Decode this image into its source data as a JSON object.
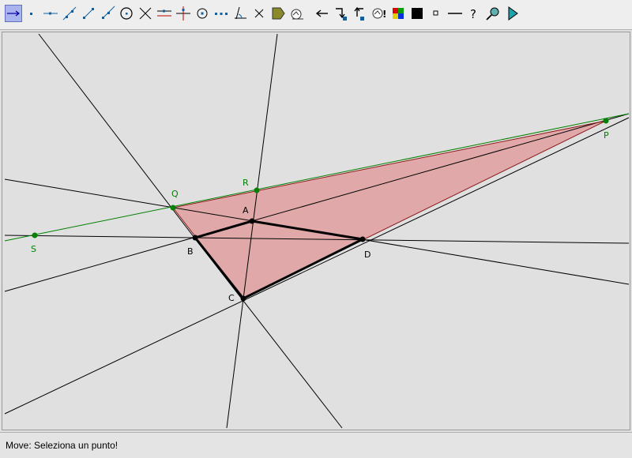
{
  "toolbar": {
    "tools": [
      {
        "name": "move-tool-icon",
        "active": true
      },
      {
        "name": "point-tool-icon"
      },
      {
        "name": "point-on-line-tool-icon"
      },
      {
        "name": "line-tool-icon"
      },
      {
        "name": "segment-tool-icon"
      },
      {
        "name": "ray-tool-icon"
      },
      {
        "name": "circle-tool-icon"
      },
      {
        "name": "intersection-tool-icon"
      },
      {
        "name": "parallel-tool-icon"
      },
      {
        "name": "perpendicular-tool-icon"
      },
      {
        "name": "center-tool-icon"
      },
      {
        "name": "midpoint-tool-icon"
      },
      {
        "name": "angle-tool-icon"
      },
      {
        "name": "delete-tool-icon"
      },
      {
        "name": "polygon-tool-icon"
      },
      {
        "name": "locus-tool-icon"
      },
      {
        "name": "undo-tool-icon"
      },
      {
        "name": "redo-tool-icon"
      },
      {
        "name": "back-tool-icon"
      },
      {
        "name": "animation-tool-icon"
      },
      {
        "name": "color-tool-icon"
      },
      {
        "name": "fill-tool-icon"
      },
      {
        "name": "point-size-tool-icon"
      },
      {
        "name": "line-style-tool-icon"
      },
      {
        "name": "help-tool-icon"
      },
      {
        "name": "zoom-tool-icon"
      },
      {
        "name": "run-tool-icon"
      }
    ]
  },
  "colors": {
    "construction_line": "#000000",
    "polygon_fill": "#e0a8a8",
    "polygon_edge": "#8b1a1a",
    "green_point": "#008000",
    "black_point": "#000000"
  },
  "points": {
    "A": {
      "label": "A",
      "color": "black"
    },
    "B": {
      "label": "B",
      "color": "black"
    },
    "C": {
      "label": "C",
      "color": "black"
    },
    "D": {
      "label": "D",
      "color": "black"
    },
    "P": {
      "label": "P",
      "color": "green"
    },
    "Q": {
      "label": "Q",
      "color": "green"
    },
    "R": {
      "label": "R",
      "color": "green"
    },
    "S": {
      "label": "S",
      "color": "green"
    }
  },
  "status": {
    "text": "Move: Seleziona un punto!"
  }
}
